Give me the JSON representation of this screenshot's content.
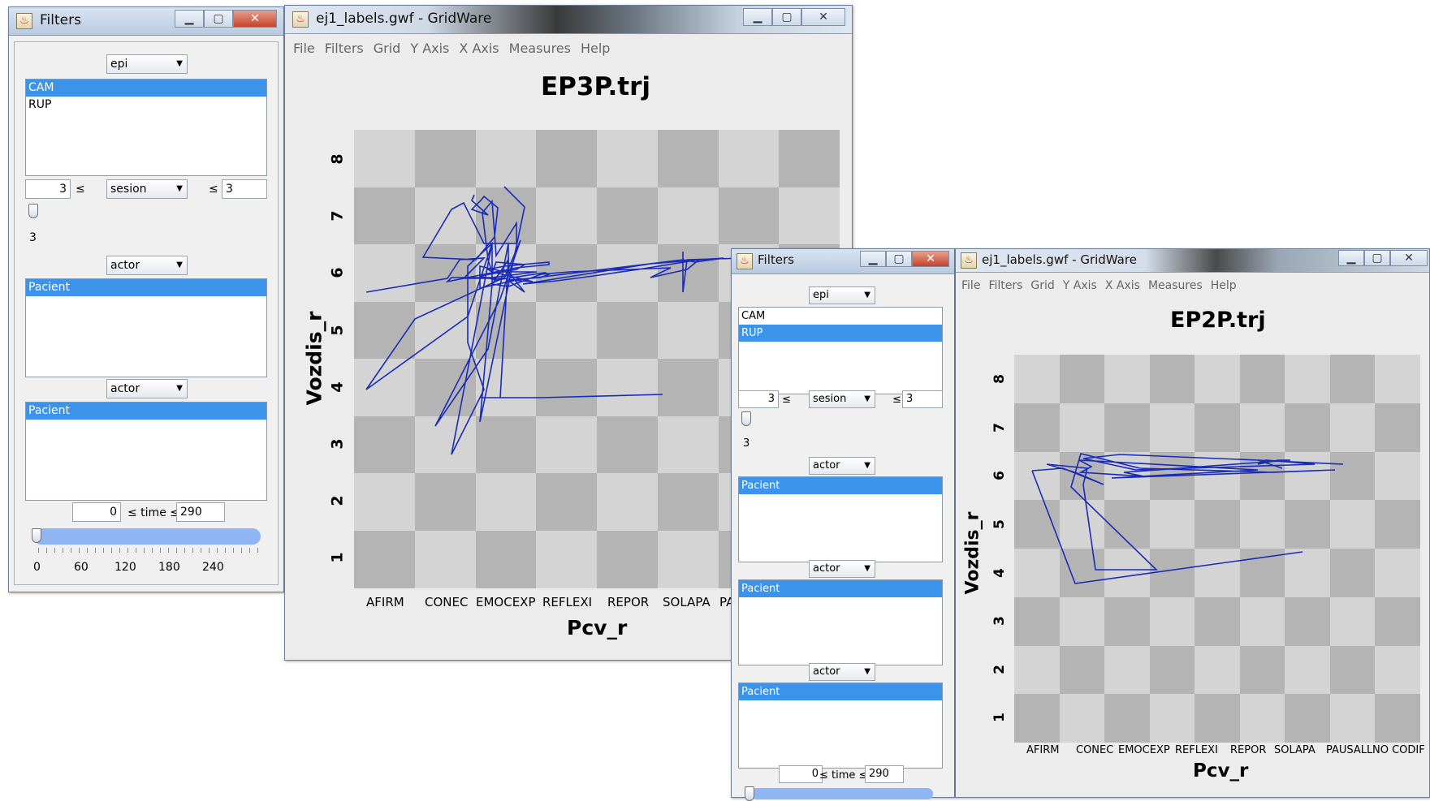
{
  "colors": {
    "selection": "#3c93ea",
    "trajectory": "#1a2cb5",
    "cell_dark": "#b4b4b4",
    "cell_light": "#d4d4d4"
  },
  "filters1": {
    "title": "Filters",
    "epi_combo": "epi",
    "epi_items": [
      {
        "label": "CAM",
        "selected": true
      },
      {
        "label": "RUP",
        "selected": false
      }
    ],
    "sesion_min": "3",
    "le1": "≤",
    "sesion_combo": "sesion",
    "le2": "≤",
    "sesion_max": "3",
    "slider_value": "3",
    "actor_combo_1": "actor",
    "actor_list_1": [
      {
        "label": "Pacient",
        "selected": true
      }
    ],
    "actor_combo_2": "actor",
    "actor_list_2": [
      {
        "label": "Pacient",
        "selected": true
      }
    ],
    "time_min": "0",
    "time_label": "≤ time ≤",
    "time_max": "290",
    "time_ticks": [
      "0",
      "60",
      "120",
      "180",
      "240"
    ]
  },
  "gw1": {
    "title": "ej1_labels.gwf - GridWare",
    "menu": [
      "File",
      "Filters",
      "Grid",
      "Y Axis",
      "X Axis",
      "Measures",
      "Help"
    ],
    "plot_title": "EP3P.trj",
    "x_label": "Pcv_r",
    "y_label": "Vozdis_r",
    "x_ticks": [
      "AFIRM",
      "CONEC",
      "EMOCEXP",
      "REFLEXI",
      "REPOR",
      "SOLAPA",
      "PA"
    ],
    "y_ticks": [
      "1",
      "2",
      "3",
      "4",
      "5",
      "6",
      "7",
      "8"
    ]
  },
  "filters2": {
    "title": "Filters",
    "epi_combo": "epi",
    "epi_items": [
      {
        "label": "CAM",
        "selected": false
      },
      {
        "label": "RUP",
        "selected": true
      }
    ],
    "sesion_min": "3",
    "le1": "≤",
    "sesion_combo": "sesion",
    "le2": "≤",
    "sesion_max": "3",
    "slider_value": "3",
    "actor_combo_1": "actor",
    "actor_list_1": [
      {
        "label": "Pacient",
        "selected": true
      }
    ],
    "actor_combo_2": "actor",
    "actor_list_2": [
      {
        "label": "Pacient",
        "selected": true
      }
    ],
    "actor_combo_3": "actor",
    "actor_list_3": [
      {
        "label": "Pacient",
        "selected": true
      }
    ],
    "time_min": "0",
    "time_label": "≤ time ≤",
    "time_max": "290"
  },
  "gw2": {
    "title": "ej1_labels.gwf - GridWare",
    "menu": [
      "File",
      "Filters",
      "Grid",
      "Y Axis",
      "X Axis",
      "Measures",
      "Help"
    ],
    "plot_title": "EP2P.trj",
    "x_label": "Pcv_r",
    "y_label": "Vozdis_r",
    "x_ticks": [
      "AFIRM",
      "CONEC",
      "EMOCEXP",
      "REFLEXI",
      "REPOR",
      "SOLAPA",
      "PAUSALL",
      "NO CODIF"
    ],
    "y_ticks": [
      "1",
      "2",
      "3",
      "4",
      "5",
      "6",
      "7",
      "8"
    ]
  }
}
